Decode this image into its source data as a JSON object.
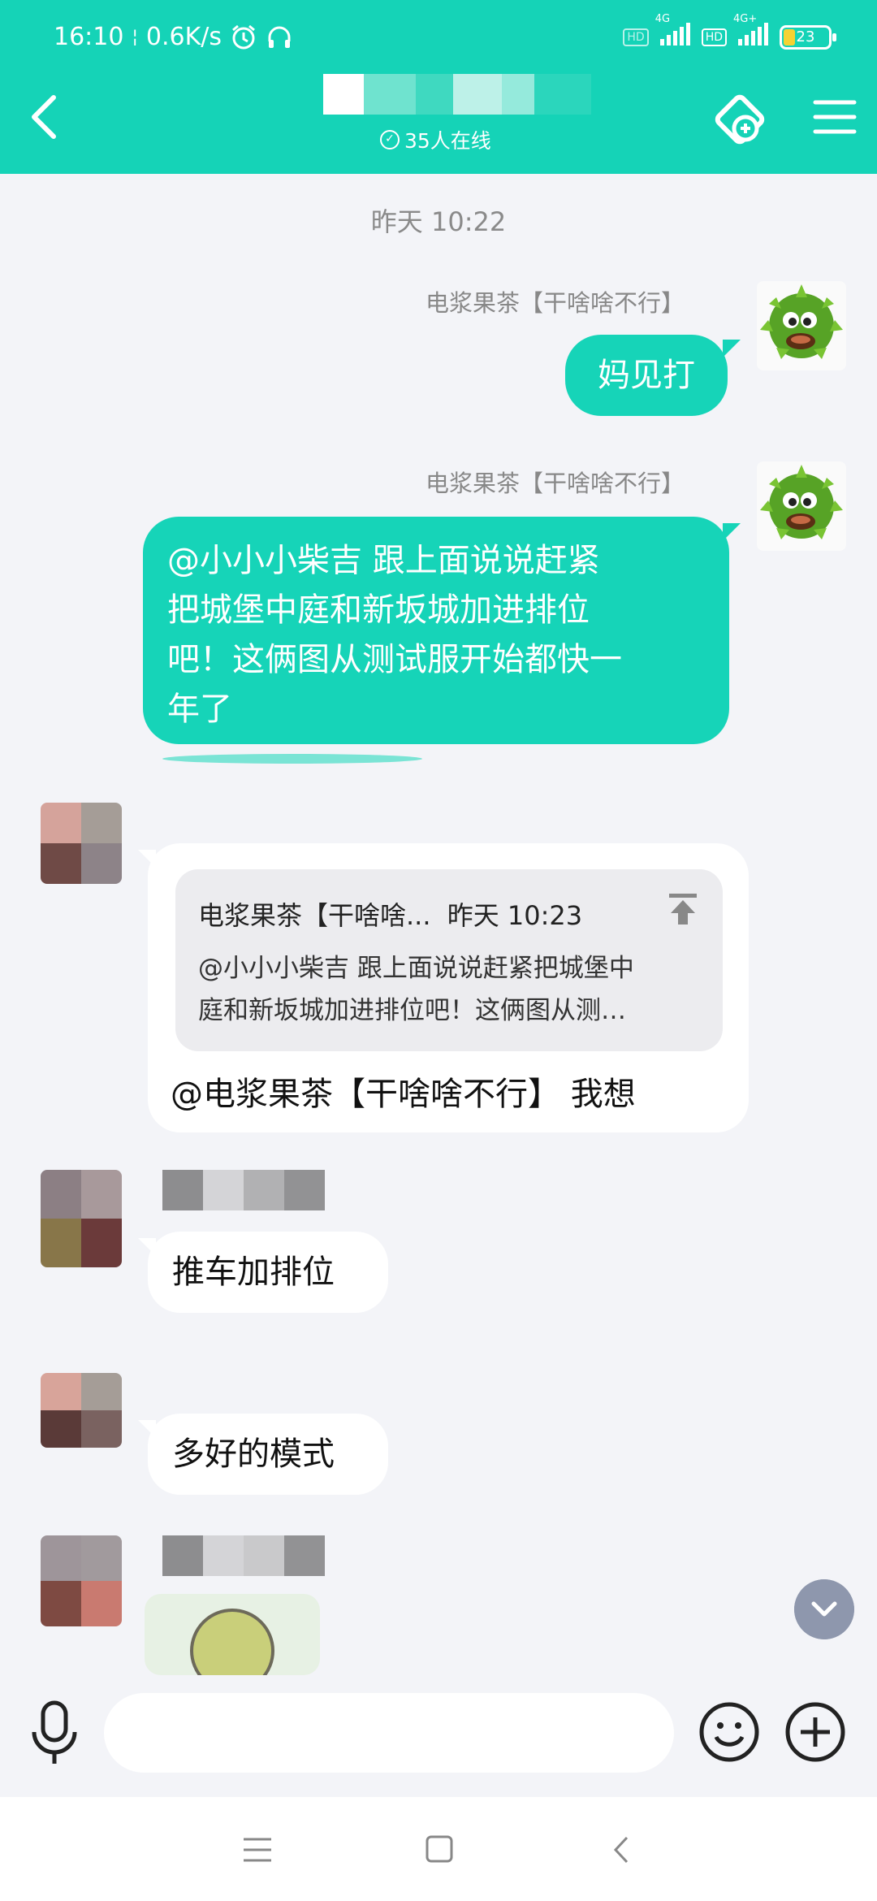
{
  "status_bar": {
    "time": "16:10",
    "separator": "¦",
    "speed": "0.6K/s",
    "net_label_1": "4G",
    "net_label_2": "4G+",
    "hd": "HD",
    "battery": "23"
  },
  "header": {
    "online_count": "35人在线"
  },
  "chat": {
    "timestamp": "昨天 10:22",
    "messages": [
      {
        "sender": "电浆果茶【干啥啥不行】",
        "text": "妈见打"
      },
      {
        "sender": "电浆果茶【干啥啥不行】",
        "text_lines": [
          "@小小小柴吉 跟上面说说赶紧",
          "把城堡中庭和新坂城加进排位",
          "吧！这俩图从测试服开始都快一",
          "年了"
        ]
      },
      {
        "quote_sender": "电浆果茶【干啥啥...",
        "quote_time": "昨天 10:23",
        "quote_lines": [
          "@小小小柴吉 跟上面说说赶紧把城堡中",
          "庭和新坂城加进排位吧！这俩图从测…"
        ],
        "text": "@电浆果茶【干啥啥不行】 我想"
      },
      {
        "text": "推车加排位"
      },
      {
        "text": "多好的模式"
      }
    ]
  },
  "colors": {
    "accent": "#15d3b7",
    "background": "#f3f4f8",
    "scroll_button": "#8e97ad"
  },
  "icons": [
    "back-arrow-icon",
    "game-link-icon",
    "menu-icon",
    "mic-icon",
    "emoji-icon",
    "plus-icon",
    "chevron-down-icon",
    "pin-top-icon",
    "alarm-icon",
    "headset-icon"
  ]
}
